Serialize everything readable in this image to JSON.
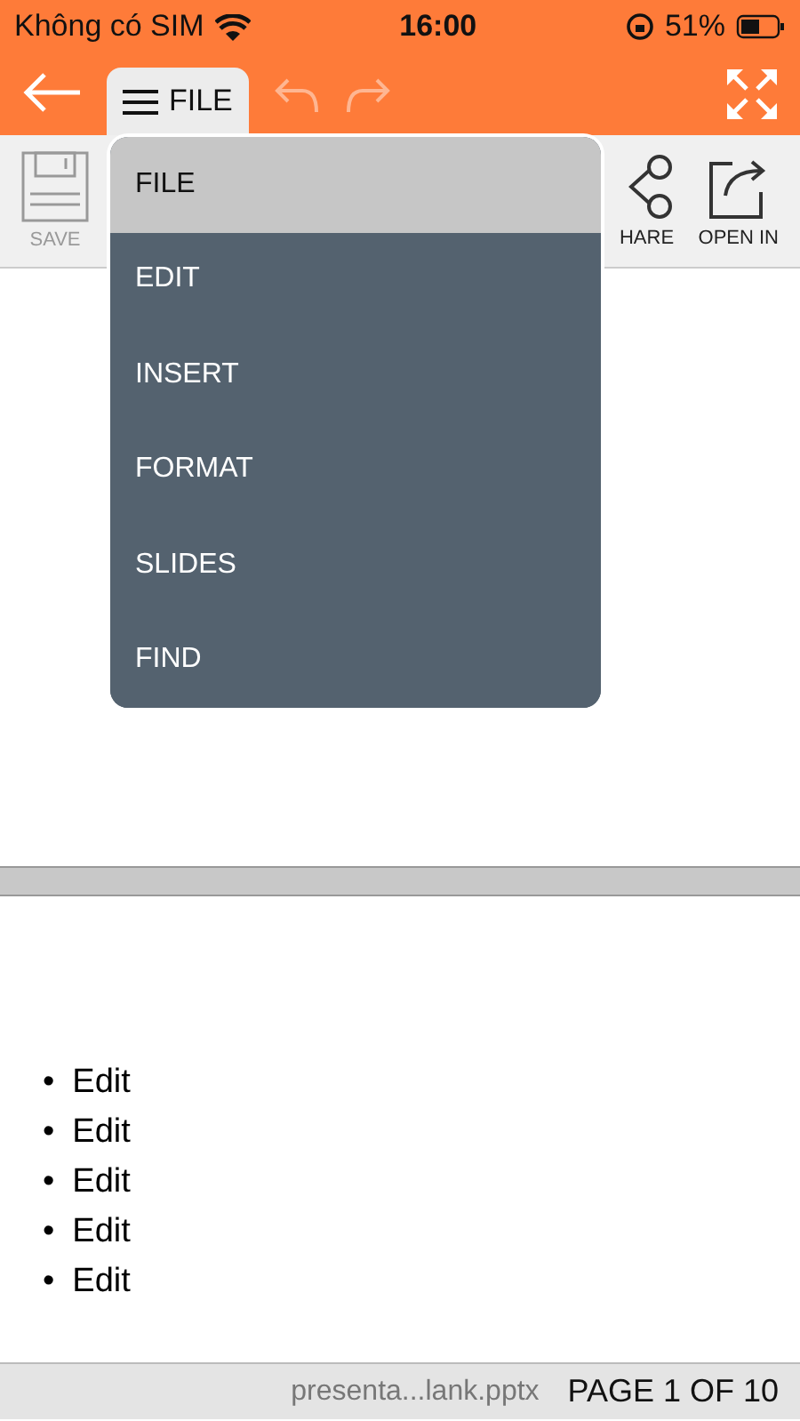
{
  "status_bar": {
    "carrier": "Không có SIM",
    "time": "16:00",
    "battery": "51%"
  },
  "toolbar": {
    "tab": {
      "label": "FILE",
      "selected": true
    },
    "undo": {
      "disabled": true
    },
    "redo": {
      "disabled": true
    }
  },
  "ribbon": [
    {
      "kind": "save",
      "label": "SAVE",
      "disabled": true
    },
    {
      "kind": "share",
      "label": "HARE",
      "disabled": false
    },
    {
      "kind": "open",
      "label": "OPEN IN",
      "disabled": false
    }
  ],
  "menu": [
    {
      "label": "FILE",
      "selected": true
    },
    {
      "label": "EDIT",
      "selected": false
    },
    {
      "label": "INSERT",
      "selected": false
    },
    {
      "label": "FORMAT",
      "selected": false
    },
    {
      "label": "SLIDES",
      "selected": false
    },
    {
      "label": "FIND",
      "selected": false
    }
  ],
  "slide": {
    "bullets": [
      {
        "marker": "•",
        "text": "Edit"
      },
      {
        "marker": "•",
        "text": "Edit"
      },
      {
        "marker": "•",
        "text": "Edit"
      },
      {
        "marker": "•",
        "text": "Edit"
      },
      {
        "marker": "•",
        "text": "Edit"
      }
    ]
  },
  "footer": {
    "file_name": "presenta...lank.pptx",
    "page": "PAGE 1 OF 10"
  }
}
